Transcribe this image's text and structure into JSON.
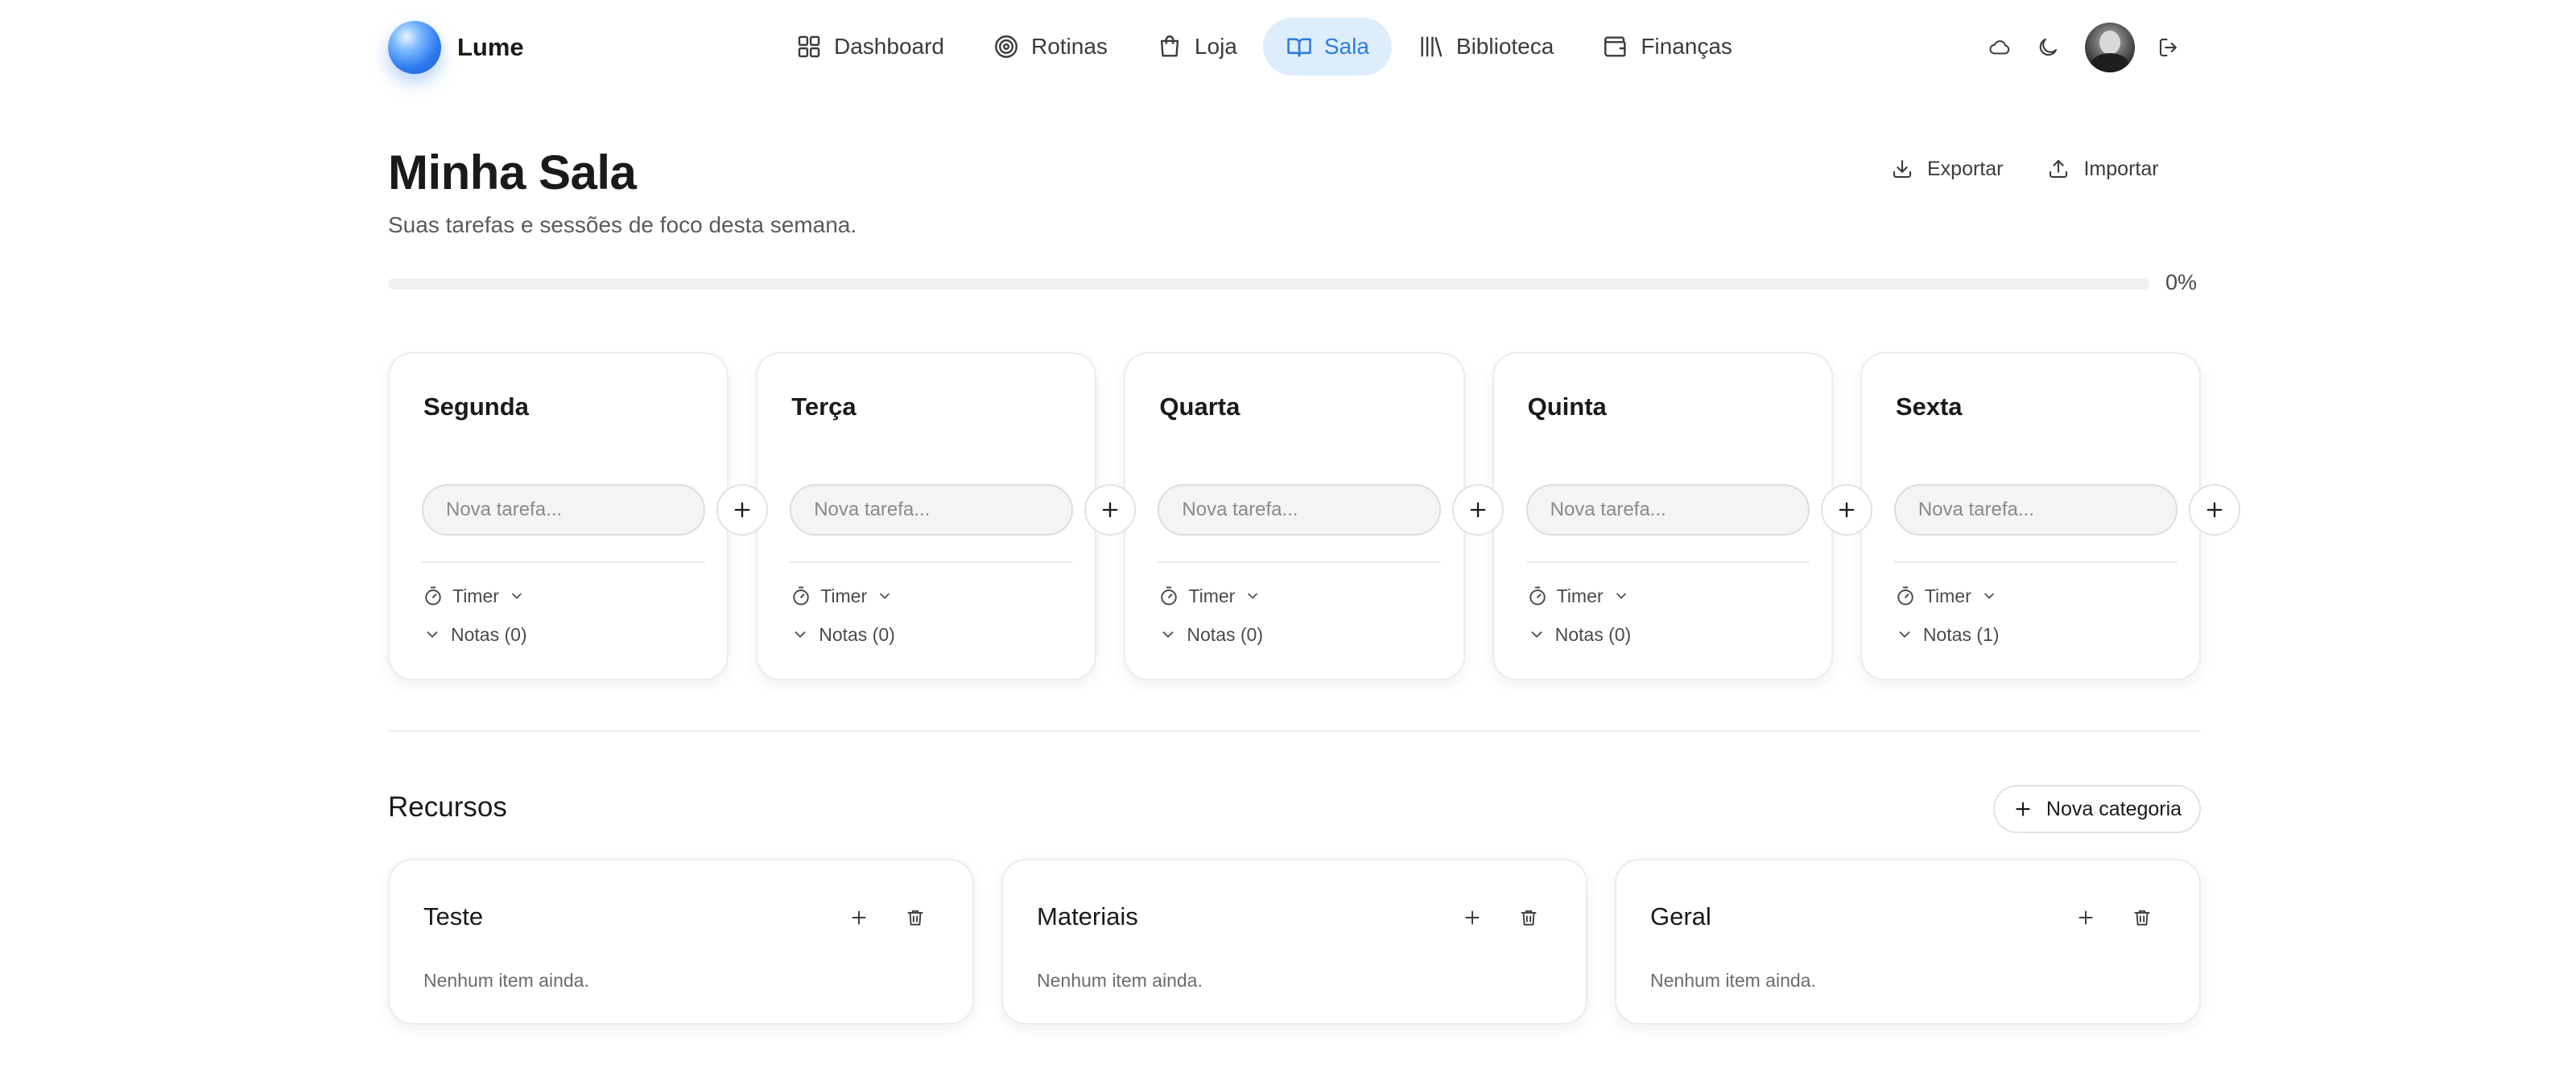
{
  "brand": {
    "name": "Lume"
  },
  "nav": [
    {
      "label": "Dashboard",
      "icon": "grid-icon",
      "active": false
    },
    {
      "label": "Rotinas",
      "icon": "target-icon",
      "active": false
    },
    {
      "label": "Loja",
      "icon": "shopping-bag-icon",
      "active": false
    },
    {
      "label": "Sala",
      "icon": "book-open-icon",
      "active": true
    },
    {
      "label": "Biblioteca",
      "icon": "library-icon",
      "active": false
    },
    {
      "label": "Finanças",
      "icon": "wallet-icon",
      "active": false
    }
  ],
  "header_icons": [
    "cloud-icon",
    "moon-icon",
    "avatar",
    "logout-icon"
  ],
  "page": {
    "title": "Minha Sala",
    "subtitle": "Suas tarefas e sessões de foco desta semana.",
    "export_label": "Exportar",
    "import_label": "Importar"
  },
  "progress": {
    "value": 0,
    "label": "0%"
  },
  "days": [
    {
      "name": "Segunda",
      "placeholder": "Nova tarefa...",
      "timer_label": "Timer",
      "notes_label": "Notas (0)"
    },
    {
      "name": "Terça",
      "placeholder": "Nova tarefa...",
      "timer_label": "Timer",
      "notes_label": "Notas (0)"
    },
    {
      "name": "Quarta",
      "placeholder": "Nova tarefa...",
      "timer_label": "Timer",
      "notes_label": "Notas (0)"
    },
    {
      "name": "Quinta",
      "placeholder": "Nova tarefa...",
      "timer_label": "Timer",
      "notes_label": "Notas (0)"
    },
    {
      "name": "Sexta",
      "placeholder": "Nova tarefa...",
      "timer_label": "Timer",
      "notes_label": "Notas (1)"
    }
  ],
  "resources": {
    "title": "Recursos",
    "new_category_label": "Nova categoria",
    "categories": [
      {
        "name": "Teste",
        "empty_text": "Nenhum item ainda."
      },
      {
        "name": "Materiais",
        "empty_text": "Nenhum item ainda."
      },
      {
        "name": "Geral",
        "empty_text": "Nenhum item ainda."
      }
    ]
  },
  "colors": {
    "accent": "#2a7de1",
    "active_nav_bg": "#deedfc",
    "text": "#1a1a1a",
    "muted": "#6b6b6b"
  }
}
